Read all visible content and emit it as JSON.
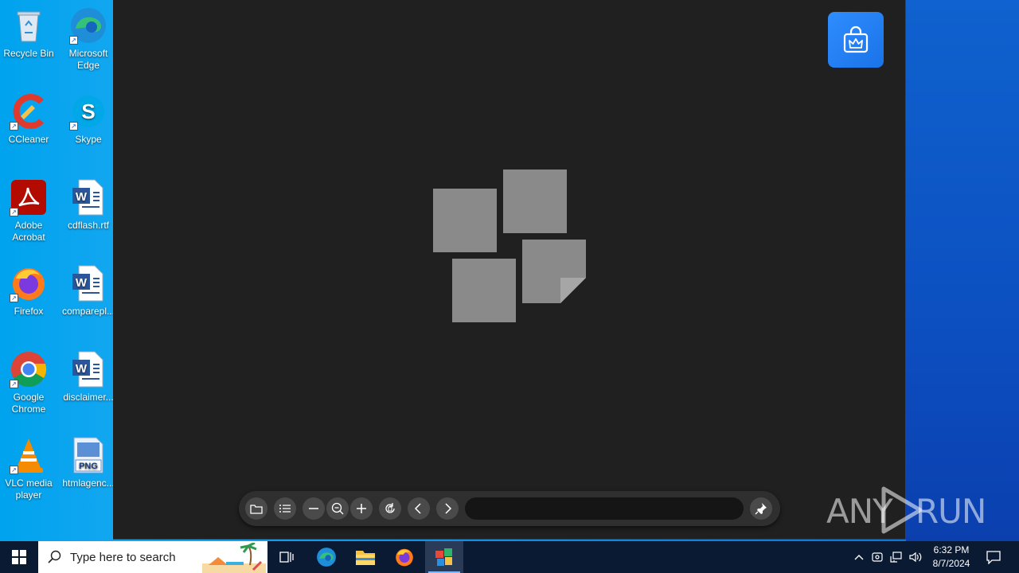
{
  "desktop": {
    "icons": [
      {
        "label": "Recycle Bin",
        "icon": "recycle-bin-icon"
      },
      {
        "label": "Microsoft Edge",
        "icon": "edge-icon"
      },
      {
        "label": "CCleaner",
        "icon": "ccleaner-icon"
      },
      {
        "label": "Skype",
        "icon": "skype-icon"
      },
      {
        "label": "Adobe Acrobat",
        "icon": "acrobat-icon"
      },
      {
        "label": "cdflash.rtf",
        "icon": "word-document-icon"
      },
      {
        "label": "Firefox",
        "icon": "firefox-icon"
      },
      {
        "label": "comparepl...",
        "icon": "word-document-icon"
      },
      {
        "label": "Google Chrome",
        "icon": "chrome-icon"
      },
      {
        "label": "disclaimer...",
        "icon": "word-document-icon"
      },
      {
        "label": "VLC media player",
        "icon": "vlc-icon"
      },
      {
        "label": "htmlagenc...",
        "icon": "png-file-icon"
      }
    ]
  },
  "viewer": {
    "store_button_icon": "shopping-bag-crown-icon",
    "toolbar": {
      "buttons": [
        "open-folder-icon",
        "list-icon",
        "zoom-out-minus-icon",
        "fit-zoom-icon",
        "zoom-in-plus-icon",
        "rotate-icon",
        "previous-icon",
        "next-icon",
        "pin-icon"
      ],
      "filename": ""
    }
  },
  "watermark": {
    "text_left": "ANY",
    "text_right": "RUN"
  },
  "taskbar": {
    "search_placeholder": "Type here to search",
    "apps": [
      "task-view-icon",
      "edge-icon",
      "file-explorer-icon",
      "firefox-icon",
      "image-viewer-icon"
    ],
    "clock_time": "6:32 PM",
    "clock_date": "8/7/2024"
  },
  "colors": {
    "viewer_bg": "#202020",
    "accent": "#1a73e8",
    "taskbar": "#0b1a33"
  }
}
